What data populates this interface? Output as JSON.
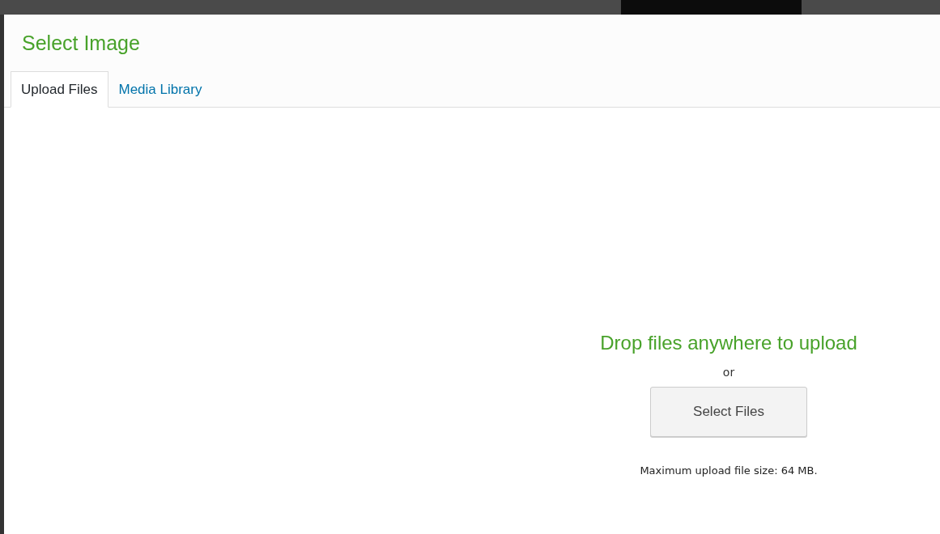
{
  "title": "Select Image",
  "tabs": [
    {
      "label": "Upload Files",
      "selected": true
    },
    {
      "label": "Media Library",
      "selected": false
    }
  ],
  "uploader": {
    "instructions": "Drop files anywhere to upload",
    "separator": "or",
    "button": "Select Files",
    "max_size": "Maximum upload file size: 64 MB."
  }
}
